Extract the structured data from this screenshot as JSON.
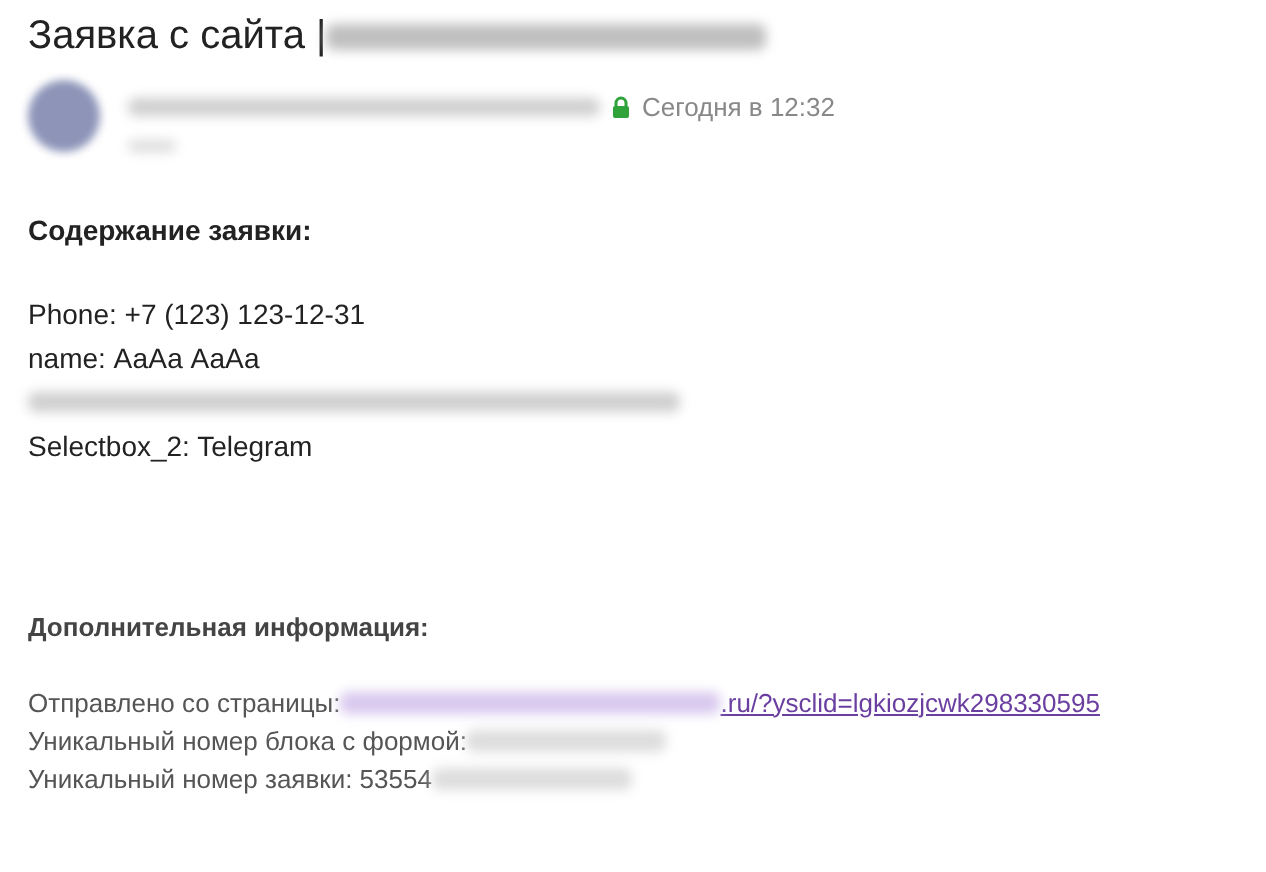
{
  "subject": "Заявка с сайта |",
  "meta": {
    "secure": true,
    "time": "Сегодня в 12:32"
  },
  "content": {
    "heading": "Содержание заявки:",
    "lines": [
      {
        "kind": "text",
        "text": "Phone: +7 (123) 123-12-31"
      },
      {
        "kind": "text",
        "text": "name: АаАа АаАа"
      },
      {
        "kind": "redacted"
      },
      {
        "kind": "text",
        "text": "Selectbox_2: Telegram"
      }
    ]
  },
  "extra": {
    "heading": "Дополнительная информация:",
    "lines": [
      {
        "label": "Отправлено со страницы:",
        "link": ".ru/?ysclid=lgkiozjcwk298330595",
        "blurred": true
      },
      {
        "label": "Уникальный номер блока с формой:",
        "blurred": true
      },
      {
        "label": "Уникальный номер заявки: 53554",
        "blurred": true
      }
    ]
  }
}
